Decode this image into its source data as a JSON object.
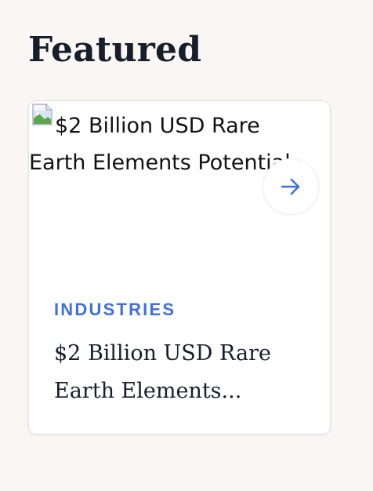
{
  "section": {
    "title": "Featured"
  },
  "card": {
    "image_alt": "$2 Billion USD Rare Earth Elements Potential",
    "category": "INDUSTRIES",
    "title": "$2 Billion USD Rare Earth Elements...",
    "arrow_icon": "arrow-right-icon",
    "image_icon": "broken-image-icon"
  },
  "colors": {
    "accent": "#3f6fe0",
    "heading": "#161d2b",
    "background": "#f9f6f3",
    "card": "#ffffff"
  }
}
